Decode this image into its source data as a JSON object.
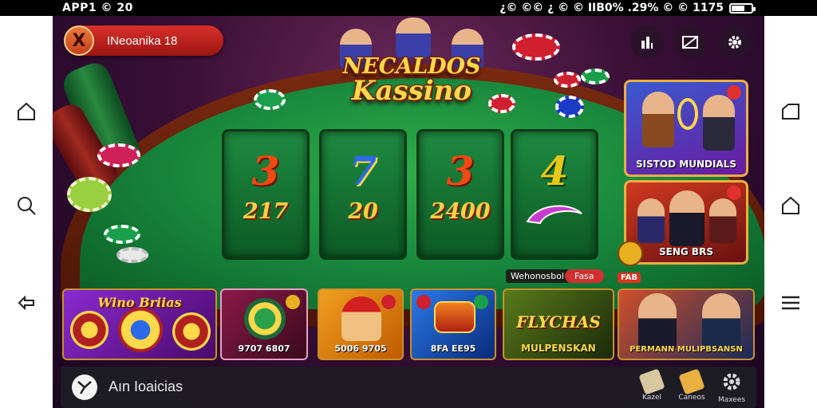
{
  "status_bar": {
    "left": "APP1 © 20",
    "right": "¿© ©© ¿ © © IIB0% .29% © © 1175"
  },
  "top_pill": {
    "close": "X",
    "label": "INeoanika 18"
  },
  "logo": {
    "line1": "NECALDOS",
    "line2": "Kassino"
  },
  "reels": [
    {
      "symbol": "3",
      "value": "217",
      "color": "#f04a12"
    },
    {
      "symbol": "7",
      "value": "20",
      "color": "#2a6ae8"
    },
    {
      "symbol": "3",
      "value": "2400",
      "color": "#f04a12"
    },
    {
      "symbol": "4",
      "value": "",
      "color": "#e6c818"
    }
  ],
  "promos": [
    {
      "caption": "SISTOD MUNDIALS",
      "badge": "",
      "bg": "#2a3a9a"
    },
    {
      "caption": "SENG BRS",
      "badge": "",
      "bg": "#9a1a10"
    }
  ],
  "tags": {
    "label": "Wehonosbol",
    "pill": "Fasa",
    "new": "FAB"
  },
  "tiles": [
    {
      "title": "Wino Briias",
      "caption": "",
      "bg": "#6a1aa0"
    },
    {
      "title": "",
      "caption": "9707 6807",
      "bg": "#6a1a3a"
    },
    {
      "title": "",
      "caption": "5006 9705",
      "bg": "#e08a10"
    },
    {
      "title": "",
      "caption": "8FA EE95",
      "bg": "#1a5ac8"
    },
    {
      "title": "FLYCHAS",
      "caption": "MULPENSKAN",
      "bg": "#3a5a0a"
    },
    {
      "title": "",
      "caption": "PERMANN MULIPBSANSN",
      "bg": "#3a1a1a"
    }
  ],
  "bottom_bar": {
    "text": "Aın Ioaicias",
    "actions": [
      {
        "label": "Kazel"
      },
      {
        "label": "Caneos"
      },
      {
        "label": "Maxees"
      }
    ]
  },
  "colors": {
    "accent": "#d9302a",
    "felt": "#16823a",
    "gold": "#ffd94a"
  }
}
